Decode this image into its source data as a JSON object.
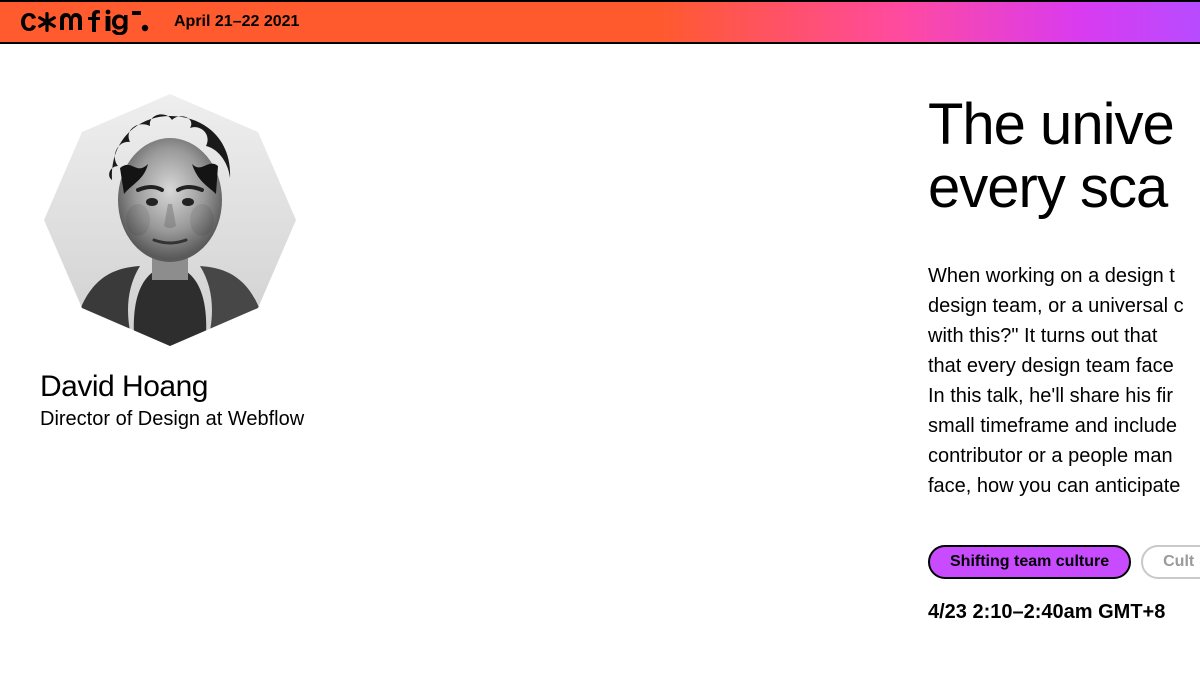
{
  "header": {
    "logo_text": "config",
    "date_label": "April 21–22 2021"
  },
  "speaker": {
    "name": "David Hoang",
    "title": "Director of Design at Webflow"
  },
  "talk": {
    "title_line1": "The unive",
    "title_line2": "every sca",
    "description": "When working on a design t\ndesign team, or a universal c\nwith this?\" It turns out that \nthat every design team face\nIn this talk, he'll share his fir\nsmall timeframe and include\ncontributor or a people man\nface, how you can anticipate",
    "time": "4/23 2:10–2:40am GMT+8"
  },
  "tags": [
    {
      "label": "Shifting team culture",
      "active": true
    },
    {
      "label": "Cult",
      "active": false
    }
  ],
  "colors": {
    "accent_orange": "#ff5b2e",
    "accent_magenta": "#c84bff"
  }
}
